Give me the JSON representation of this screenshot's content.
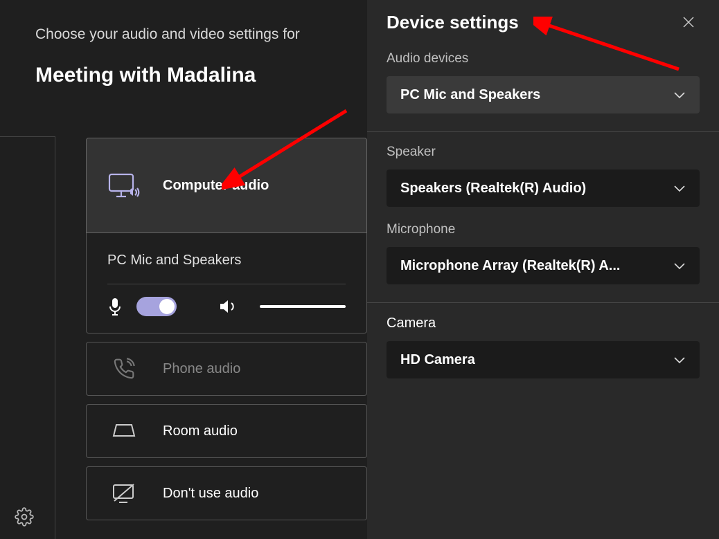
{
  "prejoin": {
    "intro": "Choose your audio and video settings for",
    "meeting_title": "Meeting with Madalina",
    "options": {
      "computer_audio": "Computer audio",
      "phone_audio": "Phone audio",
      "room_audio": "Room audio",
      "dont_use_audio": "Don't use audio"
    },
    "selected_device": "PC Mic and Speakers"
  },
  "settings": {
    "title": "Device settings",
    "audio_devices": {
      "label": "Audio devices",
      "value": "PC Mic and Speakers"
    },
    "speaker": {
      "label": "Speaker",
      "value": "Speakers (Realtek(R) Audio)"
    },
    "microphone": {
      "label": "Microphone",
      "value": "Microphone Array (Realtek(R) A..."
    },
    "camera": {
      "label": "Camera",
      "value": "HD Camera"
    }
  }
}
